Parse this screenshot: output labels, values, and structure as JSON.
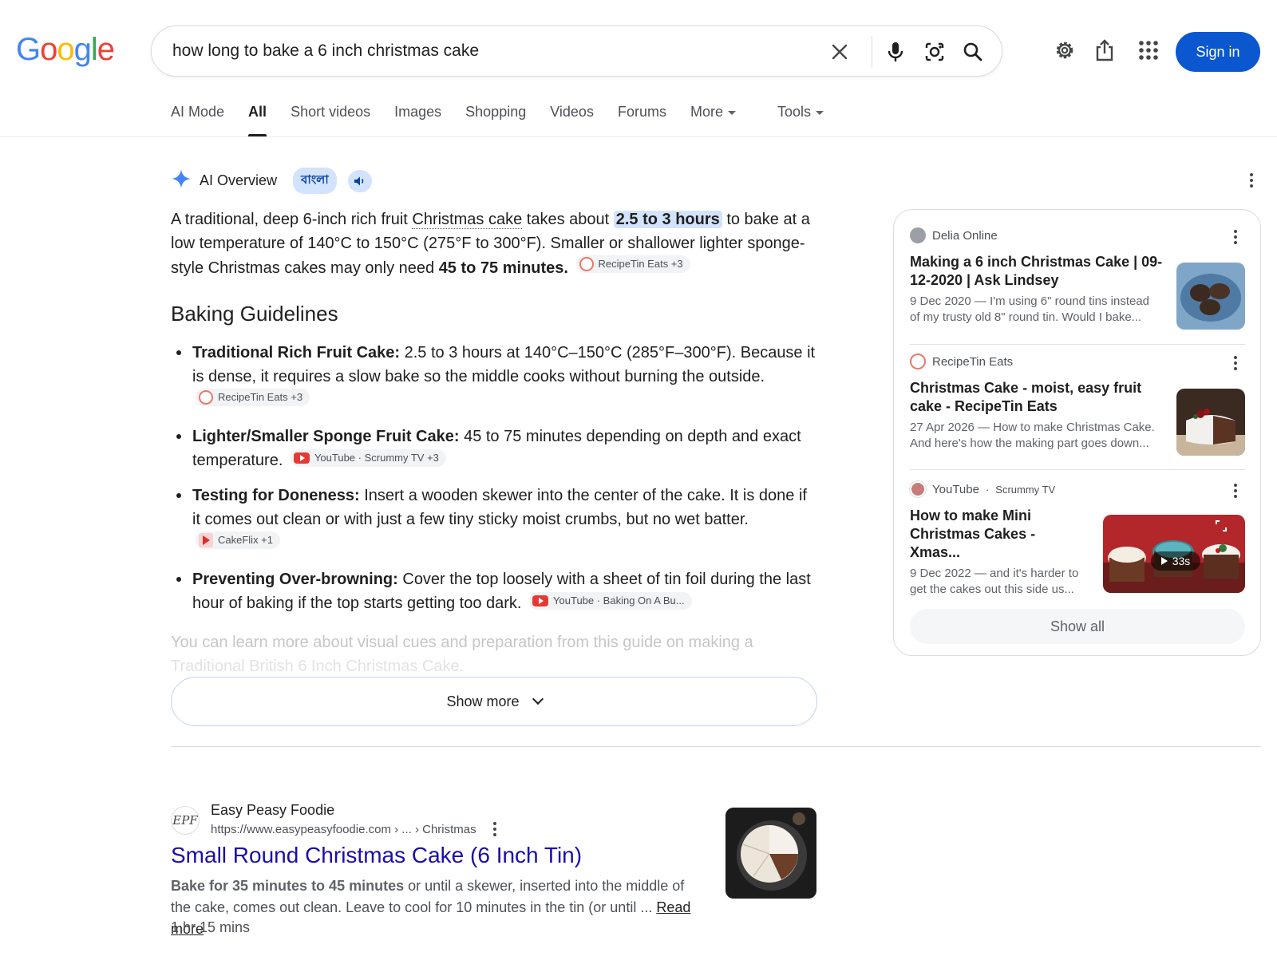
{
  "brand": {
    "letters": [
      "G",
      "o",
      "o",
      "g",
      "l",
      "e"
    ],
    "colors": [
      "#4285F4",
      "#EA4335",
      "#FBBC05",
      "#4285F4",
      "#34A853",
      "#EA4335"
    ]
  },
  "search": {
    "query": "how long to bake a 6 inch christmas cake"
  },
  "header": {
    "signin_label": "Sign in"
  },
  "tabs": [
    {
      "label": "AI Mode"
    },
    {
      "label": "All",
      "active": true
    },
    {
      "label": "Short videos"
    },
    {
      "label": "Images"
    },
    {
      "label": "Shopping"
    },
    {
      "label": "Videos"
    },
    {
      "label": "Forums"
    },
    {
      "label": "More"
    },
    {
      "label": "Tools"
    }
  ],
  "ai_overview": {
    "title": "AI Overview",
    "language_chip": "বাংলা",
    "intro": {
      "p1": "A traditional, deep 6-inch rich fruit ",
      "link": "Christmas cake",
      "p2": " takes about ",
      "highlight": "2.5 to 3 hours",
      "p3": " to bake at a low temperature of 140°C to 150°C (275°F to 300°F). Smaller or shallower lighter sponge-style Christmas cakes may only need ",
      "bold": "45 to 75 minutes.",
      "source": "RecipeTin Eats +3"
    },
    "heading": "Baking Guidelines",
    "bullets": [
      {
        "title": "Traditional Rich Fruit Cake:",
        "text": " 2.5 to 3 hours at 140°C–150°C (285°F–300°F). Because it is dense, it requires a slow bake so the middle cooks without burning the outside.",
        "source": "RecipeTin Eats +3"
      },
      {
        "title": "Lighter/Smaller Sponge Fruit Cake:",
        "text": " 45 to 75 minutes depending on depth and exact temperature.",
        "source": "YouTube · Scrummy TV +3"
      },
      {
        "title": "Testing for Doneness:",
        "text": " Insert a wooden skewer into the center of the cake. It is done if it comes out clean or with just a few tiny sticky moist crumbs, but no wet batter.",
        "source": "CakeFlix +1"
      },
      {
        "title": "Preventing Over-browning:",
        "text": " Cover the top loosely with a sheet of tin foil during the last hour of baking if the top starts getting too dark.",
        "source": "YouTube · Baking On A Bu..."
      }
    ],
    "fade_line1": "You can learn more about visual cues and preparation from this guide on making a",
    "fade_line2": "Traditional British 6 Inch Christmas Cake.",
    "show_more": "Show more"
  },
  "sources_panel": {
    "items": [
      {
        "site": "Delia Online",
        "title": "Making a 6 inch Christmas Cake | 09-12-2020 | Ask Lindsey",
        "snippet": "9 Dec 2020 — I'm using 6\" round tins instead of my trusty old 8\" round tin. Would I bake..."
      },
      {
        "site": "RecipeTin Eats",
        "title": "Christmas Cake - moist, easy fruit cake - RecipeTin Eats",
        "snippet": "27 Apr 2026 — How to make Christmas Cake. And here's how the making part goes down..."
      },
      {
        "site": "YouTube",
        "channel": "Scrummy TV",
        "title": "How to make Mini Christmas Cakes - Xmas...",
        "snippet": "9 Dec 2022 — and it's harder to get the cakes out this side us...",
        "duration": "33s"
      }
    ],
    "show_all": "Show all"
  },
  "result": {
    "favicon_text": "EPF",
    "site": "Easy Peasy Foodie",
    "url": "https://www.easypeasyfoodie.com › ... › Christmas",
    "title": "Small Round Christmas Cake (6 Inch Tin)",
    "snippet_bold": "Bake for 35 minutes to 45 minutes",
    "snippet_rest": " or until a skewer, inserted into the middle of the cake, comes out clean. Leave to cool for 10 minutes in the tin (or until ... ",
    "read_more": "Read more",
    "time": "1 hr 15 mins"
  }
}
